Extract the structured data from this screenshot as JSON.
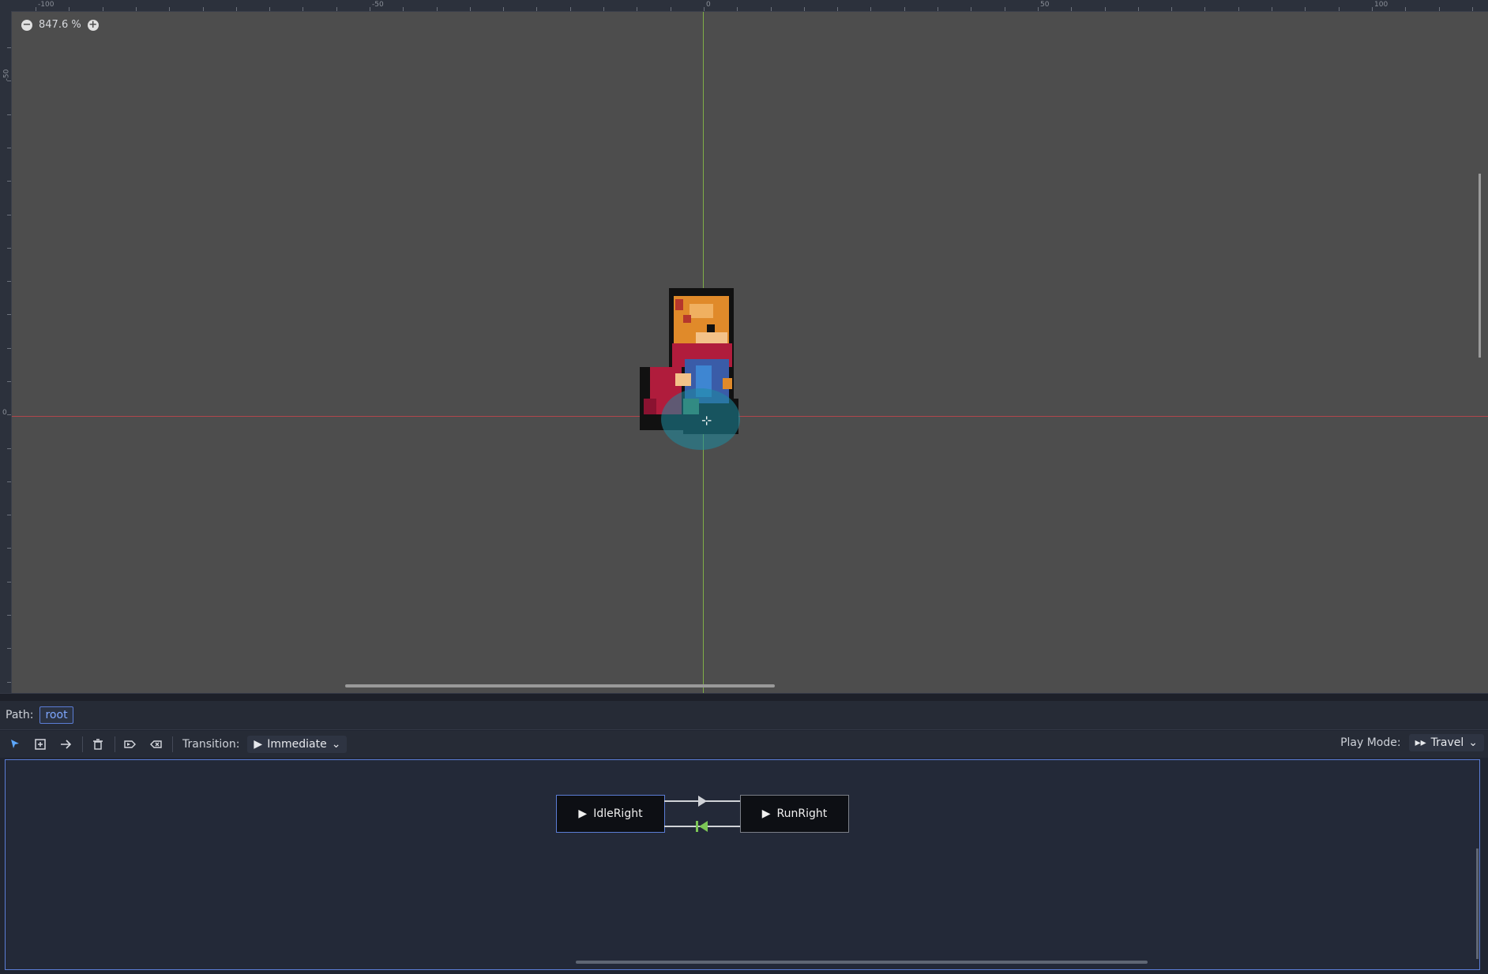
{
  "ruler": {
    "top_labels": [
      "-100",
      "-50",
      "0",
      "50",
      "100"
    ],
    "left_labels": [
      "-50",
      "0"
    ]
  },
  "viewport": {
    "zoom_text": "847.6 %",
    "zoom_out_icon": "minus-circle-icon",
    "zoom_in_icon": "plus-circle-icon",
    "x_axis_color": "#b0474c",
    "y_axis_color": "#7fae47"
  },
  "path": {
    "label": "Path:",
    "value": "root"
  },
  "toolbar": {
    "tools": [
      "select-icon",
      "create-node-icon",
      "connect-icon",
      "delete-icon",
      "set-start-icon",
      "set-end-icon"
    ],
    "transition_label": "Transition:",
    "transition_value": "Immediate",
    "play_mode_label": "Play Mode:",
    "play_mode_value": "Travel"
  },
  "graph": {
    "nodes": [
      {
        "name": "IdleRight",
        "selected": true
      },
      {
        "name": "RunRight",
        "selected": false
      }
    ],
    "accent": "#5b7dd6",
    "start_marker_color": "#7cc656"
  }
}
